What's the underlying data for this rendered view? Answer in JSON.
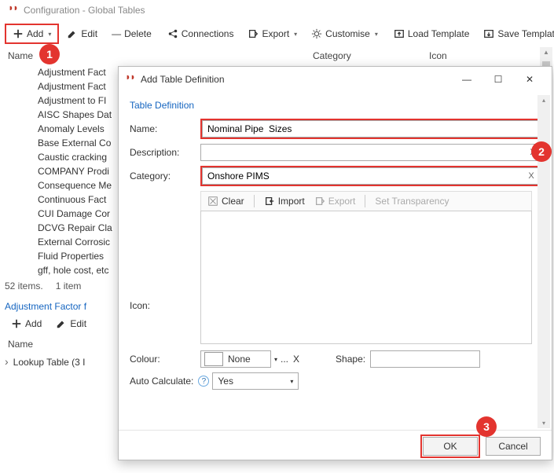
{
  "window": {
    "title": "Configuration - Global Tables"
  },
  "toolbar": {
    "add": "Add",
    "edit": "Edit",
    "delete": "Delete",
    "connections": "Connections",
    "export": "Export",
    "customise": "Customise",
    "load_template": "Load Template",
    "save_template": "Save Template"
  },
  "columns": {
    "name": "Name",
    "category": "Category",
    "icon": "Icon"
  },
  "rows": [
    "Adjustment Fact",
    "Adjustment Fact",
    "Adjustment to FI",
    "AISC Shapes Dat",
    "Anomaly Levels",
    "Base External Co",
    "Caustic cracking",
    "COMPANY Prodi",
    "Consequence Me",
    "Continuous Fact",
    "CUI Damage Cor",
    "DCVG Repair Cla",
    "External Corrosic",
    "Fluid Properties",
    "gff, hole cost, etc"
  ],
  "status": {
    "total": "52 items.",
    "selected": "1 item"
  },
  "panel2": {
    "title": "Adjustment Factor f",
    "add": "Add",
    "edit": "Edit",
    "col": "Name",
    "row": "Lookup Table (3 I"
  },
  "dialog": {
    "title": "Add Table Definition",
    "group": "Table Definition",
    "name_label": "Name:",
    "name_value": "Nominal Pipe  Sizes",
    "desc_label": "Description:",
    "desc_value": "",
    "cat_label": "Category:",
    "cat_value": "Onshore PIMS",
    "clear": "Clear",
    "import": "Import",
    "export": "Export",
    "set_transparency": "Set Transparency",
    "icon_label": "Icon:",
    "colour_label": "Colour:",
    "colour_value": "None",
    "shape_label": "Shape:",
    "auto_label": "Auto Calculate:",
    "auto_value": "Yes",
    "ok": "OK",
    "cancel": "Cancel"
  },
  "callouts": {
    "c1": "1",
    "c2": "2",
    "c3": "3"
  }
}
